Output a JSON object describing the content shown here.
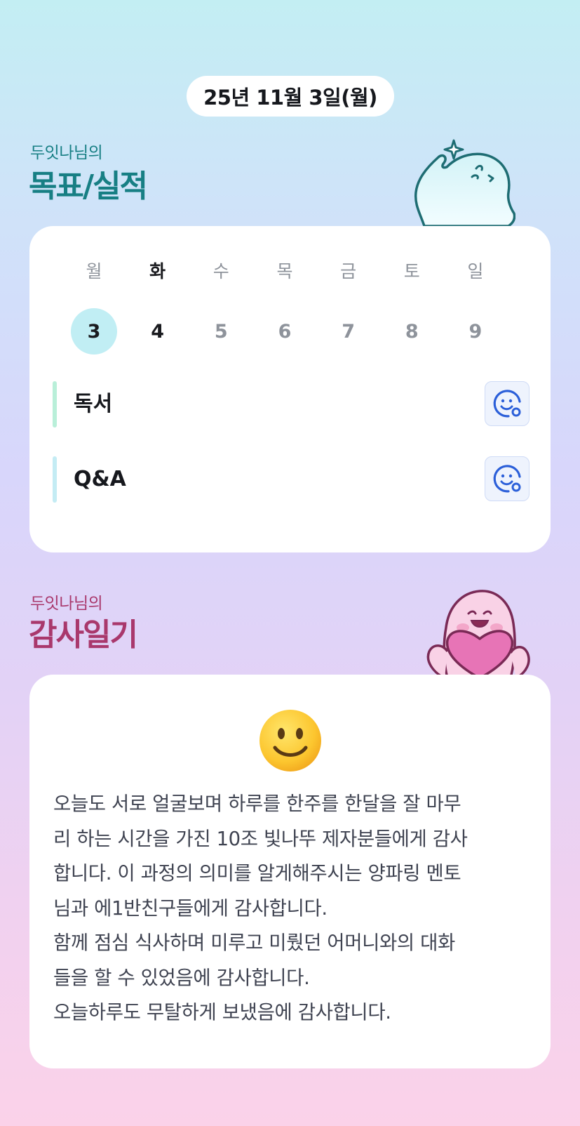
{
  "header": {
    "date": "25년 11월 3일(월)"
  },
  "goals_section": {
    "subtitle": "두잇나님의",
    "title": "목표/실적",
    "colors": {
      "accent": "#177f84"
    }
  },
  "week": [
    {
      "weekday": "월",
      "date": "3",
      "state": "selected"
    },
    {
      "weekday": "화",
      "date": "4",
      "state": "today"
    },
    {
      "weekday": "수",
      "date": "5",
      "state": "normal"
    },
    {
      "weekday": "목",
      "date": "6",
      "state": "normal"
    },
    {
      "weekday": "금",
      "date": "7",
      "state": "normal"
    },
    {
      "weekday": "토",
      "date": "8",
      "state": "normal"
    },
    {
      "weekday": "일",
      "date": "9",
      "state": "normal"
    }
  ],
  "goals": [
    {
      "label": "독서",
      "bar_color": "#b9efd9",
      "icon": "smile-face-icon"
    },
    {
      "label": "Q&A",
      "bar_color": "#c4ecf4",
      "icon": "smile-face-icon"
    }
  ],
  "gratitude_section": {
    "subtitle": "두잇나님의",
    "title": "감사일기",
    "colors": {
      "accent": "#a9386c"
    }
  },
  "diary": {
    "mood_icon": "slightly-smiling-face-icon",
    "text": "오늘도 서로 얼굴보며 하루를 한주를 한달을 잘 마무\n리 하는 시간을 가진 10조 빛나뚜 제자분들에게 감사\n합니다. 이 과정의 의미를 알게해주시는 양파링 멘토\n님과 에1반친구들에게 감사합니다.\n함께 점심 식사하며 미루고 미뤘던 어머니와의 대화\n들을 할 수 있었음에 감사합니다.\n오늘하루도 무탈하게 보냈음에 감사합니다."
  }
}
